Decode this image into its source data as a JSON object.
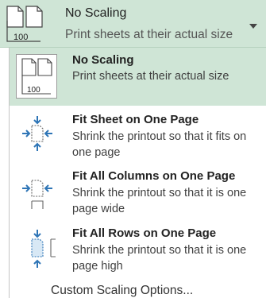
{
  "dropdown": {
    "selected_title": "No Scaling",
    "selected_subtitle": "Print sheets at their actual size",
    "icon_number": "100"
  },
  "options": [
    {
      "title": "No Scaling",
      "desc": "Print sheets at their actual size",
      "icon": "no-scaling-icon",
      "icon_number": "100"
    },
    {
      "title": "Fit Sheet on One Page",
      "desc": "Shrink the printout so that it fits on one page",
      "icon": "fit-sheet-icon"
    },
    {
      "title": "Fit All Columns on One Page",
      "desc": "Shrink the printout so that it is one page wide",
      "icon": "fit-columns-icon"
    },
    {
      "title": "Fit All Rows on One Page",
      "desc": "Shrink the printout so that it is one page high",
      "icon": "fit-rows-icon"
    }
  ],
  "custom_label": "Custom Scaling Options...",
  "colors": {
    "highlight": "#cfe5d6",
    "arrow_blue": "#2e75b6"
  }
}
